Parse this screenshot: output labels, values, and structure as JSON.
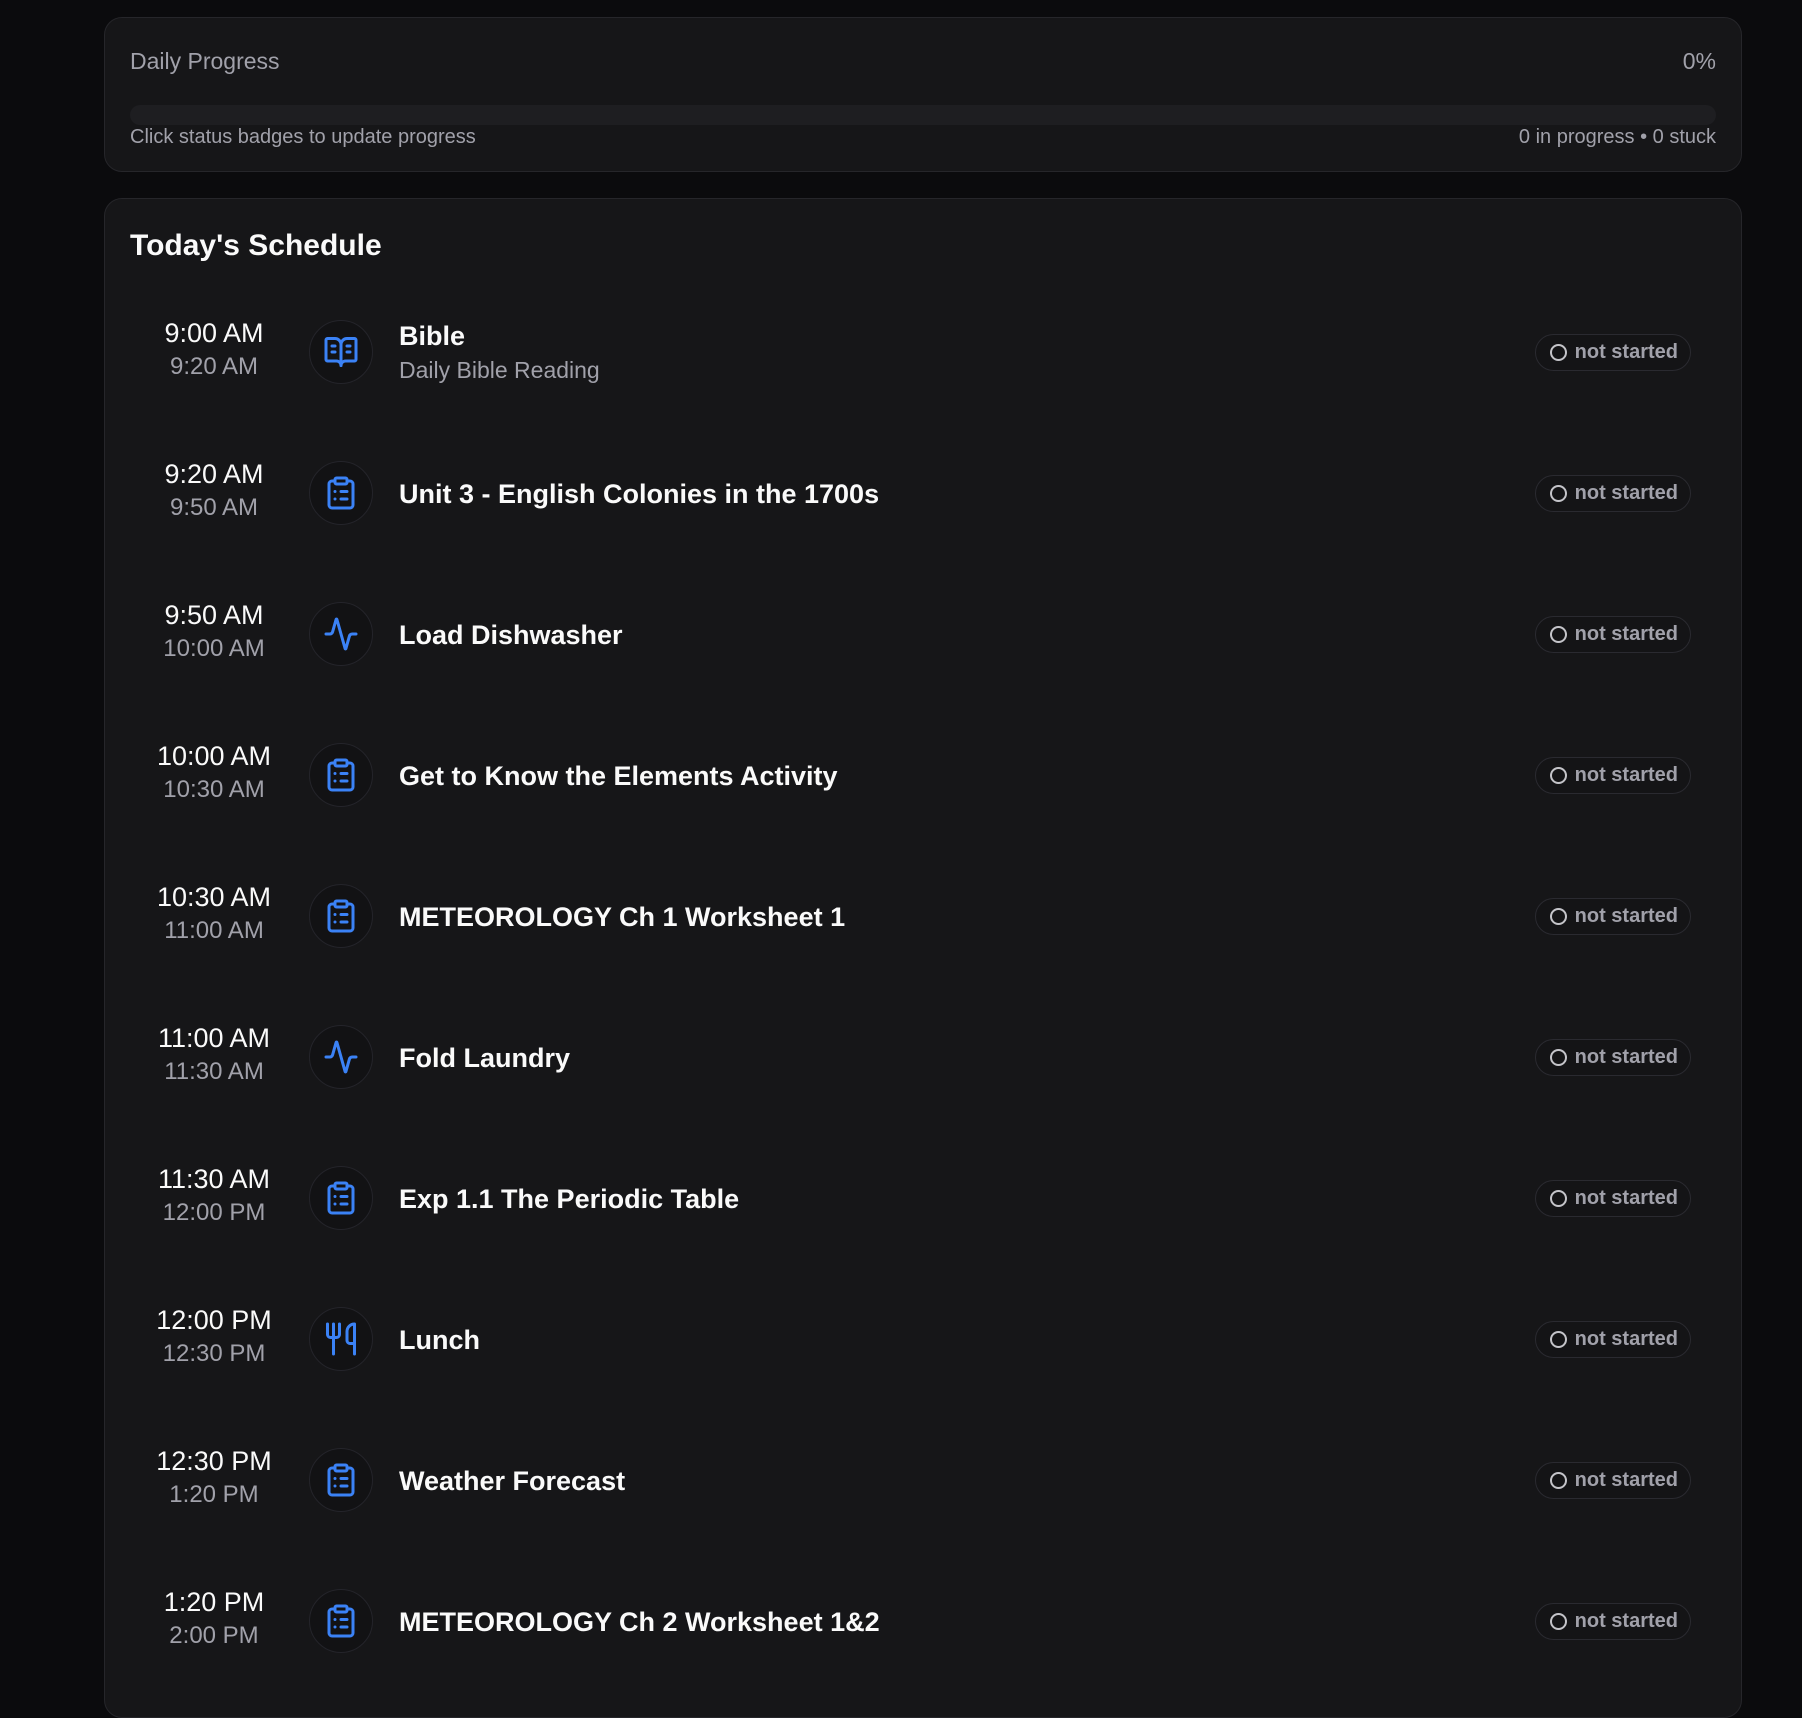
{
  "progress": {
    "title": "Daily Progress",
    "percent_label": "0%",
    "percent": 0,
    "hint": "Click status badges to update progress",
    "summary": "0 in progress • 0 stuck"
  },
  "schedule": {
    "title": "Today's Schedule",
    "items": [
      {
        "start": "9:00 AM",
        "end": "9:20 AM",
        "icon": "book-open-icon",
        "title": "Bible",
        "subtitle": "Daily Bible Reading",
        "status": "not started"
      },
      {
        "start": "9:20 AM",
        "end": "9:50 AM",
        "icon": "clipboard-list-icon",
        "title": "Unit 3 - English Colonies in the 1700s",
        "subtitle": "",
        "status": "not started"
      },
      {
        "start": "9:50 AM",
        "end": "10:00 AM",
        "icon": "activity-icon",
        "title": "Load Dishwasher",
        "subtitle": "",
        "status": "not started"
      },
      {
        "start": "10:00 AM",
        "end": "10:30 AM",
        "icon": "clipboard-list-icon",
        "title": "Get to Know the Elements Activity",
        "subtitle": "",
        "status": "not started"
      },
      {
        "start": "10:30 AM",
        "end": "11:00 AM",
        "icon": "clipboard-list-icon",
        "title": "METEOROLOGY Ch 1 Worksheet 1",
        "subtitle": "",
        "status": "not started"
      },
      {
        "start": "11:00 AM",
        "end": "11:30 AM",
        "icon": "activity-icon",
        "title": "Fold Laundry",
        "subtitle": "",
        "status": "not started"
      },
      {
        "start": "11:30 AM",
        "end": "12:00 PM",
        "icon": "clipboard-list-icon",
        "title": "Exp 1.1 The Periodic Table",
        "subtitle": "",
        "status": "not started"
      },
      {
        "start": "12:00 PM",
        "end": "12:30 PM",
        "icon": "utensils-icon",
        "title": "Lunch",
        "subtitle": "",
        "status": "not started"
      },
      {
        "start": "12:30 PM",
        "end": "1:20 PM",
        "icon": "clipboard-list-icon",
        "title": "Weather Forecast",
        "subtitle": "",
        "status": "not started"
      },
      {
        "start": "1:20 PM",
        "end": "2:00 PM",
        "icon": "clipboard-list-icon",
        "title": "METEOROLOGY Ch 2 Worksheet 1&2",
        "subtitle": "",
        "status": "not started"
      }
    ]
  },
  "colors": {
    "accent": "#3b82f6",
    "background": "#0b0b0d",
    "card": "#161618",
    "muted_text": "#a1a1aa"
  }
}
